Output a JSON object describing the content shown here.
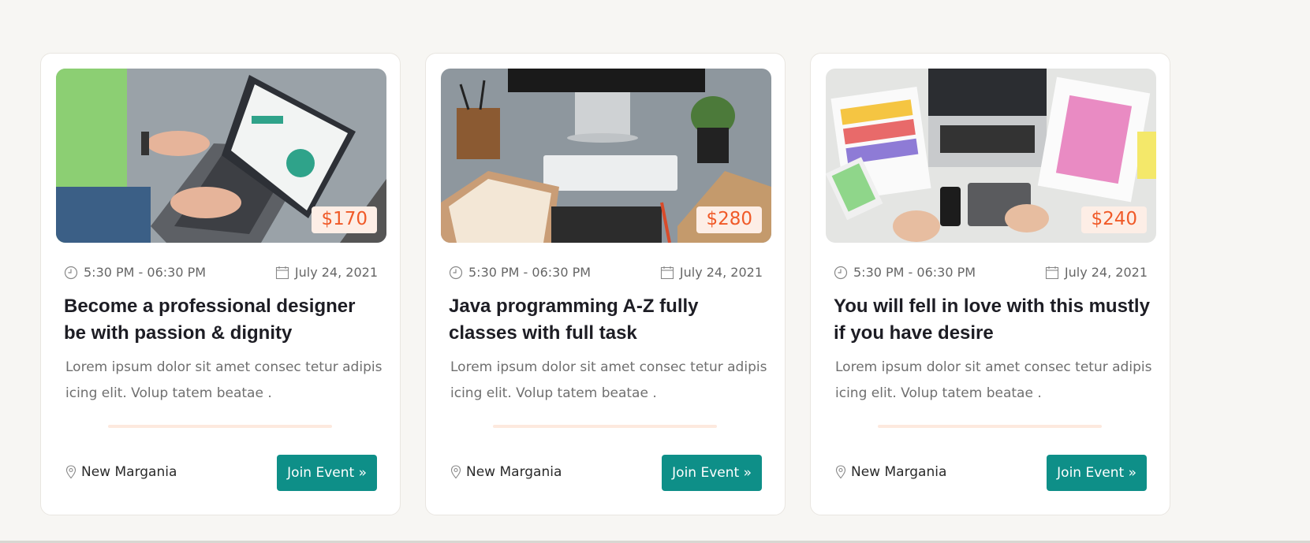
{
  "events": [
    {
      "price": "$170",
      "time": "5:30 PM - 06:30 PM",
      "date": "July 24, 2021",
      "title": "Become a professional designer be with passion & dignity",
      "description": "Lorem ipsum dolor sit amet consec tetur adipis icing elit. Volup tatem beatae .",
      "location": "New Margania",
      "button": "Join Event »",
      "image_alt": "laptop-programming-photo"
    },
    {
      "price": "$280",
      "time": "5:30 PM - 06:30 PM",
      "date": "July 24, 2021",
      "title": "Java programming A-Z fully classes with full task",
      "description": "Lorem ipsum dolor sit amet consec tetur adipis icing elit. Volup tatem beatae .",
      "location": "New Margania",
      "button": "Join Event »",
      "image_alt": "desk-workspace-photo"
    },
    {
      "price": "$240",
      "time": "5:30 PM - 06:30 PM",
      "date": "July 24, 2021",
      "title": "You will fell in love with this mustly if you have desire",
      "description": "Lorem ipsum dolor sit amet consec tetur adipis icing elit. Volup tatem beatae .",
      "location": "New Margania",
      "button": "Join Event »",
      "image_alt": "design-color-palette-photo"
    }
  ],
  "colors": {
    "accent": "#0e8f88",
    "price_text": "#f05a28",
    "price_bg": "#fdeee6",
    "divider": "#fde9de"
  },
  "icons": {
    "time": "clock-icon",
    "date": "calendar-icon",
    "location": "map-pin-icon"
  }
}
